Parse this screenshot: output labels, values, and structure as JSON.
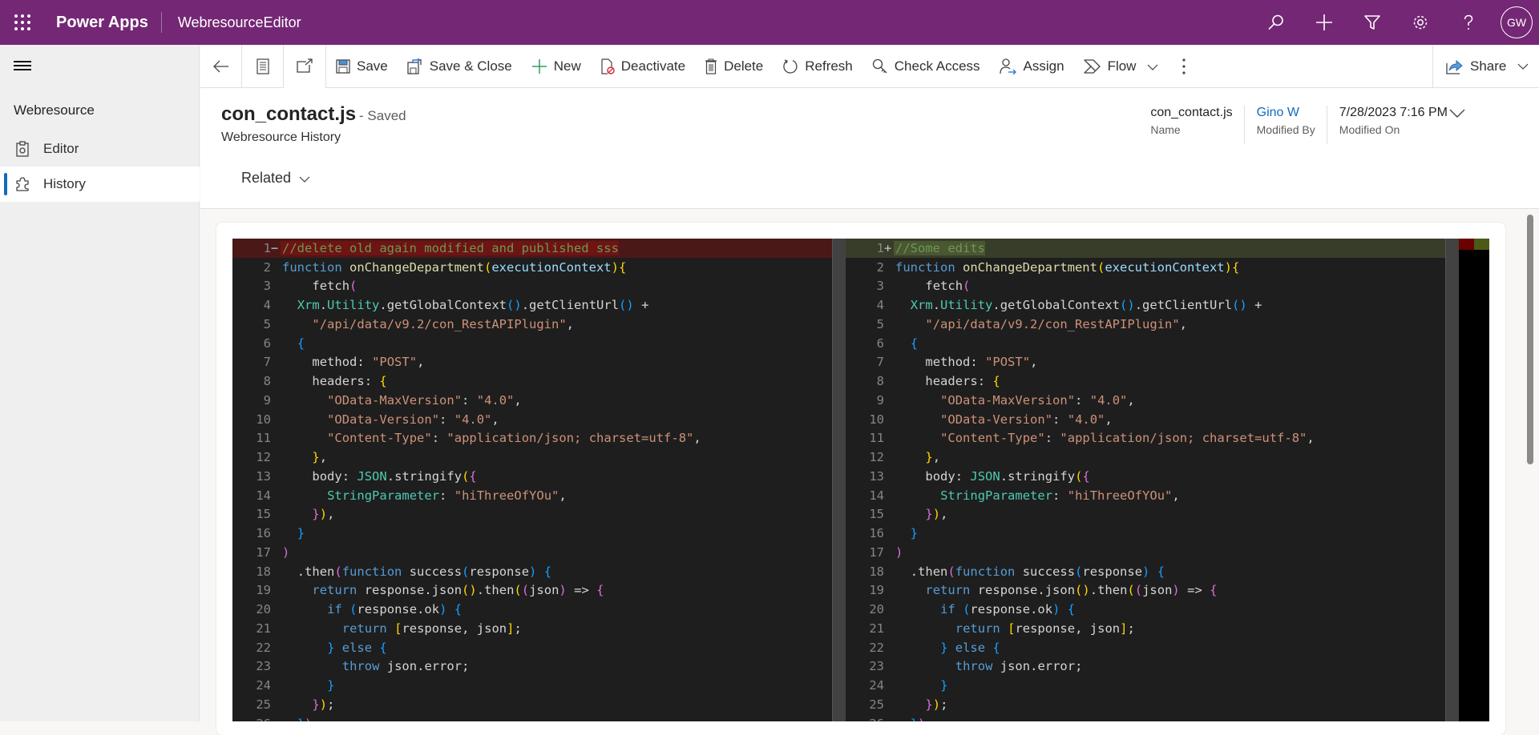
{
  "topbar": {
    "brand": "Power Apps",
    "app_name": "WebresourceEditor",
    "icons": [
      "search-icon",
      "add-icon",
      "filter-icon",
      "settings-icon",
      "help-icon"
    ],
    "avatar_initials": "GW",
    "bg_color": "#742774"
  },
  "sidebar": {
    "section_title": "Webresource",
    "items": [
      {
        "label": "Editor",
        "icon": "editor-icon",
        "active": false
      },
      {
        "label": "History",
        "icon": "puzzle-icon",
        "active": true
      }
    ]
  },
  "commandbar": {
    "buttons": [
      {
        "label": "Save",
        "icon": "save-icon"
      },
      {
        "label": "Save & Close",
        "icon": "save-close-icon"
      },
      {
        "label": "New",
        "icon": "add-icon"
      },
      {
        "label": "Deactivate",
        "icon": "deactivate-icon"
      },
      {
        "label": "Delete",
        "icon": "delete-icon"
      },
      {
        "label": "Refresh",
        "icon": "refresh-icon"
      },
      {
        "label": "Check Access",
        "icon": "key-icon"
      },
      {
        "label": "Assign",
        "icon": "assign-icon"
      },
      {
        "label": "Flow",
        "icon": "flow-icon"
      }
    ],
    "share_label": "Share"
  },
  "record": {
    "title": "con_contact.js",
    "status": "- Saved",
    "subtitle": "Webresource History",
    "related_label": "Related",
    "fields": [
      {
        "value": "con_contact.js",
        "label": "Name"
      },
      {
        "value": "Gino W",
        "label": "Modified By",
        "link": true
      },
      {
        "value": "7/28/2023 7:16 PM",
        "label": "Modified On"
      }
    ]
  },
  "diff": {
    "original": {
      "line1": "//delete old again modified and published sss",
      "line1_sign": "−"
    },
    "modified": {
      "line1": "//Some edits",
      "line1_sign": "+"
    },
    "shared_lines": [
      "function onChangeDepartment(executionContext){",
      "    fetch(",
      "  Xrm.Utility.getGlobalContext().getClientUrl() +",
      "    \"/api/data/v9.2/con_RestAPIPlugin\",",
      "  {",
      "    method: \"POST\",",
      "    headers: {",
      "      \"OData-MaxVersion\": \"4.0\",",
      "      \"OData-Version\": \"4.0\",",
      "      \"Content-Type\": \"application/json; charset=utf-8\",",
      "    },",
      "    body: JSON.stringify({",
      "      StringParameter: \"hiThreeOfYOu\",",
      "    }),",
      "  }",
      ")",
      "  .then(function success(response) {",
      "    return response.json().then((json) => {",
      "      if (response.ok) {",
      "        return [response, json];",
      "      } else {",
      "        throw json.error;",
      "      }",
      "    });",
      "  })"
    ]
  }
}
